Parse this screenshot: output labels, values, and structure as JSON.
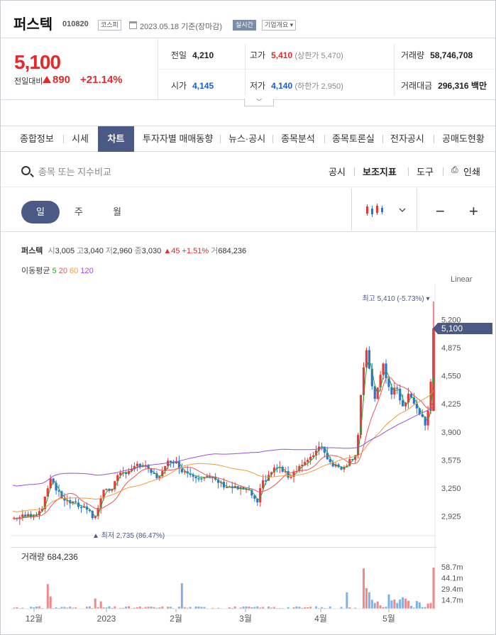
{
  "header": {
    "stock_name": "퍼스텍",
    "stock_code": "010820",
    "market_tag": "코스피",
    "date_text": "2023.05.18 기준(장마감)",
    "live_label": "실시간",
    "company_info_label": "기업개요 ▾"
  },
  "price": {
    "current": "5,100",
    "change_label": "전일대비",
    "change_amount": "890",
    "change_pct": "+21.14%"
  },
  "quote": {
    "prev_close_label": "전일",
    "prev_close": "4,210",
    "high_label": "고가",
    "high": "5,410",
    "upper_limit": "(상한가 5,470)",
    "volume_label": "거래량",
    "volume": "58,746,708",
    "open_label": "시가",
    "open": "4,145",
    "low_label": "저가",
    "low": "4,140",
    "lower_limit": "(하한가 2,950)",
    "value_label": "거래대금",
    "value": "296,316",
    "value_unit": "백만"
  },
  "nav_tabs": [
    "종합정보",
    "시세",
    "차트",
    "투자자별 매매동향",
    "뉴스·공시",
    "종목분석",
    "종목토론실",
    "전자공시",
    "공매도현황"
  ],
  "active_tab": "차트",
  "toolbar": {
    "search_placeholder": "종목 또는 지수비교",
    "disclosure": "공시",
    "indicator": "보조지표",
    "tools": "도구",
    "print": "인쇄"
  },
  "periods": [
    "일",
    "주",
    "월"
  ],
  "active_period": "일",
  "ohlc": {
    "name": "퍼스텍",
    "open_label": "시",
    "open": "3,005",
    "high_label": "고",
    "high": "3,040",
    "low_label": "저",
    "low": "2,960",
    "close_label": "종",
    "close": "3,030",
    "change": "45",
    "change_pct": "+1.51%",
    "volume_label": "거",
    "volume": "684,236"
  },
  "moving_avg": {
    "label": "이동평균",
    "periods": [
      "5",
      "20",
      "60",
      "120"
    ],
    "colors": [
      "#22a834",
      "#e8565a",
      "#f39a3c",
      "#9b4fd6"
    ]
  },
  "scale_label": "Linear",
  "chart_data": {
    "type": "candlestick",
    "max_marker": "최고 5,410 (-5.73%) ▾",
    "min_marker": "▲ 최저 2,735 (86.47%)",
    "current_price_tag": "5,100",
    "y_ticks": [
      "5,200",
      "4,875",
      "4,550",
      "4,225",
      "3,900",
      "3,575",
      "3,250",
      "2,925"
    ],
    "y_tick_values": [
      5200,
      4875,
      4550,
      4225,
      3900,
      3575,
      3250,
      2925
    ],
    "x_labels": [
      "12월",
      "2023",
      "2월",
      "3월",
      "4월",
      "5월"
    ],
    "volume_label": "거래량",
    "volume_value": "684,236",
    "volume_ticks": [
      "58.7m",
      "44.1m",
      "29.4m",
      "14.7m"
    ],
    "colors": {
      "up": "#e8393b",
      "down": "#2d73d6",
      "accent": "#4a5a84"
    }
  }
}
